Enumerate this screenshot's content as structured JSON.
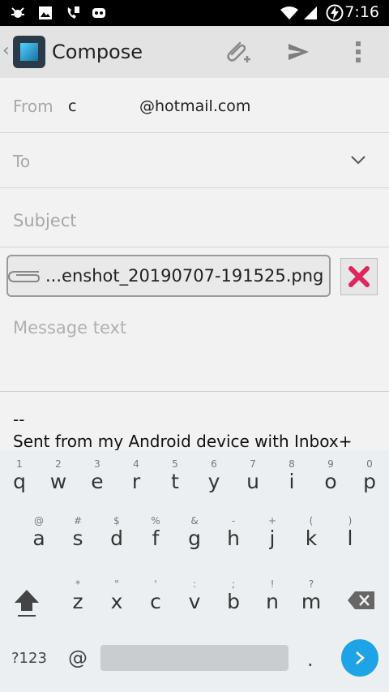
{
  "status_bar": {
    "time": "7:16",
    "left_icons": [
      "bug-notification-icon",
      "image-notification-icon",
      "call-forward-icon",
      "android-debug-icon"
    ],
    "right_icons": [
      "wifi-icon",
      "signal-icon",
      "battery-charging-icon"
    ]
  },
  "app_bar": {
    "title": "Compose",
    "actions": [
      "attach-icon",
      "send-icon",
      "overflow-menu-icon"
    ]
  },
  "from": {
    "label": "From",
    "account_prefix": "c",
    "account_domain": "@hotmail.com"
  },
  "to": {
    "placeholder": "To"
  },
  "subject": {
    "placeholder": "Subject"
  },
  "attachment": {
    "name": "...enshot_20190707-191525.png",
    "remove_color": "#e0245e"
  },
  "message": {
    "placeholder": "Message text",
    "signature_separator": "--",
    "signature_text": "Sent from my Android device with Inbox+"
  },
  "keyboard": {
    "rows": [
      [
        {
          "k": "q",
          "h": "1"
        },
        {
          "k": "w",
          "h": "2"
        },
        {
          "k": "e",
          "h": "3"
        },
        {
          "k": "r",
          "h": "4"
        },
        {
          "k": "t",
          "h": "5"
        },
        {
          "k": "y",
          "h": "6"
        },
        {
          "k": "u",
          "h": "7"
        },
        {
          "k": "i",
          "h": "8"
        },
        {
          "k": "o",
          "h": "9"
        },
        {
          "k": "p",
          "h": "0"
        }
      ],
      [
        {
          "k": "a",
          "h": "@"
        },
        {
          "k": "s",
          "h": "#"
        },
        {
          "k": "d",
          "h": "$"
        },
        {
          "k": "f",
          "h": "%"
        },
        {
          "k": "g",
          "h": "&"
        },
        {
          "k": "h",
          "h": "-"
        },
        {
          "k": "j",
          "h": "+"
        },
        {
          "k": "k",
          "h": "("
        },
        {
          "k": "l",
          "h": ")"
        }
      ],
      [
        {
          "k": "z",
          "h": "*"
        },
        {
          "k": "x",
          "h": "\""
        },
        {
          "k": "c",
          "h": "'"
        },
        {
          "k": "v",
          "h": ":"
        },
        {
          "k": "b",
          "h": ";"
        },
        {
          "k": "n",
          "h": "!"
        },
        {
          "k": "m",
          "h": "?"
        }
      ]
    ],
    "symbols_key": "?123",
    "at_key": "@",
    "period_key": ".",
    "accent_color": "#1ea3e6"
  }
}
